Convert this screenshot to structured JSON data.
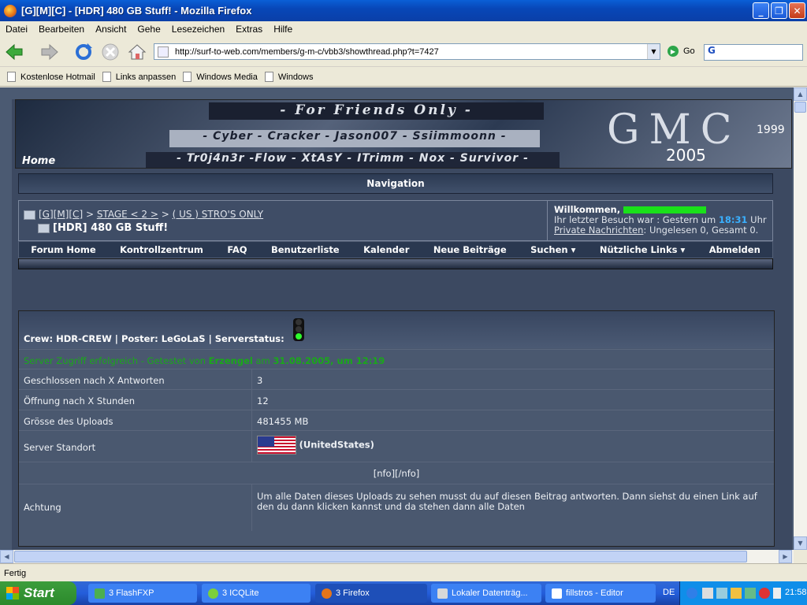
{
  "window": {
    "title": "[G][M][C] - [HDR] 480 GB Stuff! - Mozilla Firefox"
  },
  "menu": [
    "Datei",
    "Bearbeiten",
    "Ansicht",
    "Gehe",
    "Lesezeichen",
    "Extras",
    "Hilfe"
  ],
  "toolbar": {
    "url": "http://surf-to-web.com/members/g-m-c/vbb3/showthread.php?t=7427",
    "go_label": "Go",
    "search_value": "G"
  },
  "bookmarks": [
    "Kostenlose Hotmail",
    "Links anpassen",
    "Windows Media",
    "Windows"
  ],
  "banner": {
    "tagline": "- For Friends Only -",
    "row1": "- Cyber - Cracker - Jason007 - Ssiimmoonn -",
    "row2": "- Tr0j4n3r -Flow - XtAsY - ITrimm - Nox - Survivor -",
    "home": "Home",
    "logo": "GMC",
    "year1": "1999",
    "year2": "2005"
  },
  "navigation": {
    "header": "Navigation",
    "crumb1": "[G][M][C]",
    "crumb2": "STAGE < 2 >",
    "crumb3": "( US ) STRO'S ONLY",
    "thread_title": "[HDR] 480 GB Stuff!",
    "links": [
      "Forum Home",
      "Kontrollzentrum",
      "FAQ",
      "Benutzerliste",
      "Kalender",
      "Neue Beiträge",
      "Suchen ▾",
      "Nützliche Links ▾",
      "Abmelden"
    ]
  },
  "welcome": {
    "greeting": "Willkommen,",
    "last_visit": "Ihr letzter Besuch war : Gestern um",
    "time": "18:31",
    "uhr": "Uhr",
    "pm_link": "Private Nachrichten",
    "pm_status": ": Ungelesen 0, Gesamt 0."
  },
  "post": {
    "header": "Crew: HDR-CREW | Poster: LeGoLaS | Serverstatus:",
    "server_line_a": "Server Zugriff erfolgreich - Getestet von",
    "server_user": "Erzengel",
    "server_line_b": "am",
    "server_date": "31.08.2005, um 12:19",
    "rows": [
      {
        "label": "Geschlossen nach X Antworten",
        "value": "3"
      },
      {
        "label": "Öffnung nach X Stunden",
        "value": "12"
      },
      {
        "label": "Grösse des Uploads",
        "value": "481455 MB"
      },
      {
        "label": "Server Standort",
        "value": "(UnitedStates)"
      }
    ],
    "nfo": "[nfo][/nfo]",
    "achtung_label": "Achtung",
    "achtung_text": "Um alle Daten dieses Uploads zu sehen musst du auf diesen Beitrag antworten. Dann siehst du einen Link auf den du dann klicken kannst und da stehen dann alle Daten"
  },
  "status": {
    "text": "Fertig"
  },
  "taskbar": {
    "start": "Start",
    "tasks": [
      "3 FlashFXP",
      "3 ICQLite",
      "3 Firefox",
      "Lokaler Datenträg...",
      "fillstros - Editor"
    ],
    "lang": "DE",
    "clock": "21:58"
  }
}
